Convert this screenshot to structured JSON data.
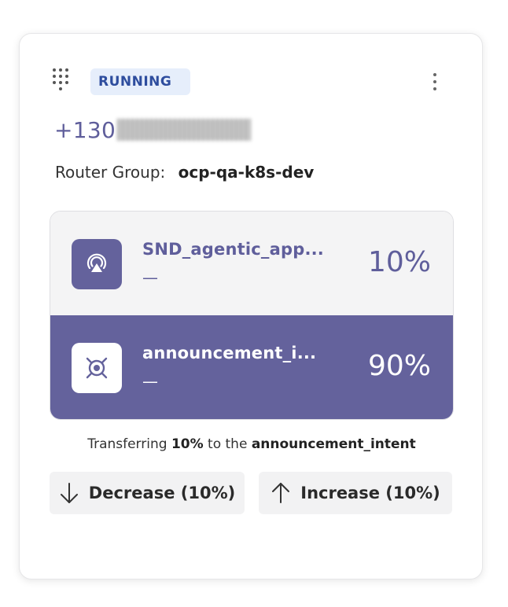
{
  "card": {
    "status_badge": "RUNNING",
    "phone_number_prefix": "+130",
    "router_group_label": "Router Group:",
    "router_group_value": "ocp-qa-k8s-dev"
  },
  "splits": [
    {
      "name": "SND_agentic_app...",
      "subtitle": "—",
      "percent": "10%",
      "icon": "broadcast-icon"
    },
    {
      "name": "announcement_i...",
      "subtitle": "—",
      "percent": "90%",
      "icon": "target-icon"
    }
  ],
  "transfer": {
    "prefix": "Transferring",
    "amount": "10%",
    "middle": "to the",
    "target": "announcement_intent"
  },
  "actions": {
    "decrease_label": "Decrease (10%)",
    "increase_label": "Increase (10%)"
  },
  "colors": {
    "accent": "#64629c",
    "badge_bg": "#e6eefb",
    "badge_text": "#2e4d9e"
  }
}
